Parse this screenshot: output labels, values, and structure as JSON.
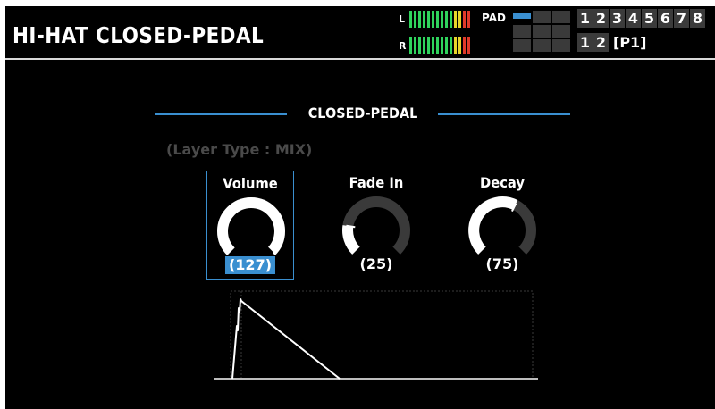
{
  "header": {
    "title": "HI-HAT CLOSED-PEDAL",
    "meter_left_label": "L",
    "meter_right_label": "R",
    "pad_label": "PAD",
    "kit_numbers_top": [
      "1",
      "2",
      "3",
      "4",
      "5",
      "6",
      "7",
      "8"
    ],
    "kit_numbers_bottom": [
      "1",
      "2"
    ],
    "kit_page": "[P1]"
  },
  "section": {
    "title": "CLOSED-PEDAL",
    "layer_type": "(Layer Type : MIX)"
  },
  "params": [
    {
      "label": "Volume",
      "value": "(127)",
      "level": 1.0,
      "selected": true
    },
    {
      "label": "Fade In",
      "value": "(25)",
      "level": 0.2,
      "selected": false
    },
    {
      "label": "Decay",
      "value": "(75)",
      "level": 0.6,
      "selected": false
    }
  ],
  "colors": {
    "accent": "#3a8fd0",
    "background": "#000000",
    "meter_green": "#2fd35c",
    "meter_yellow": "#e8d42a",
    "meter_red": "#e03a2a"
  }
}
